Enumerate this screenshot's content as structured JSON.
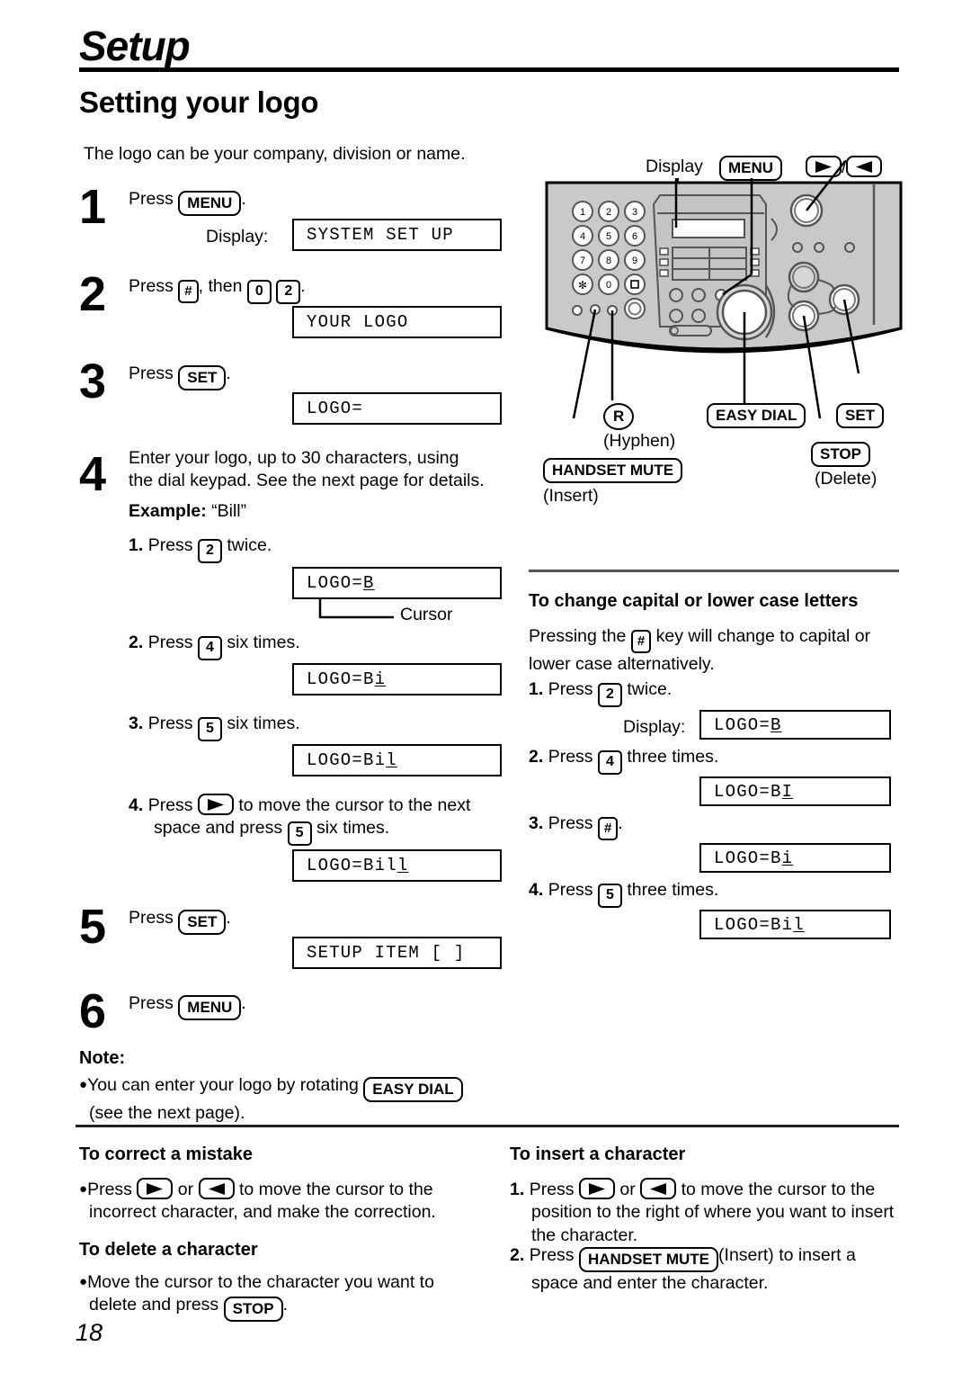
{
  "header": {
    "chapter": "Setup",
    "section_title": "Setting your logo",
    "intro": "The logo can be your company, division or name."
  },
  "page_number": "18",
  "steps": [
    {
      "number": "1",
      "text_before": "Press",
      "key": "MENU",
      "text_after": ".",
      "display_label": "Display:",
      "display_value": "SYSTEM SET UP"
    },
    {
      "number": "2",
      "text_before": "Press",
      "key": "#",
      "text_mid": ", then",
      "key2": "0",
      "key3": "2",
      "text_after": ".",
      "display_value": "YOUR LOGO"
    },
    {
      "number": "3",
      "text_before": "Press",
      "key": "SET",
      "text_after": ".",
      "display_value": "LOGO="
    },
    {
      "number": "4",
      "text_line1": "Enter your logo, up to 30 characters, using",
      "text_line2": "the dial keypad. See the next page for details.",
      "example_label": "Example:",
      "example_value": "“Bill”",
      "cursor_callout": "Cursor",
      "substeps": [
        {
          "n": "1.",
          "before": "Press",
          "key": "2",
          "after": "twice.",
          "display": "LOGO=B",
          "cursor_char": "B"
        },
        {
          "n": "2.",
          "before": "Press",
          "key": "4",
          "after": "six times.",
          "display": "LOGO=Bi",
          "cursor_char": "i"
        },
        {
          "n": "3.",
          "before": "Press",
          "key": "5",
          "after": "six times.",
          "display": "LOGO=Bil",
          "cursor_char": "l"
        },
        {
          "n": "4.",
          "before": "Press",
          "key": "right-arrow",
          "after_line1": "to move the cursor to the next",
          "after_line2a": "space and press",
          "key2": "5",
          "after_line2b": "six times.",
          "display": "LOGO=Bill",
          "cursor_char": "l"
        }
      ]
    },
    {
      "number": "5",
      "text_before": "Press",
      "key": "SET",
      "text_after": ".",
      "display_value": "SETUP ITEM [  ]"
    },
    {
      "number": "6",
      "text_before": "Press",
      "key": "MENU",
      "text_after": "."
    }
  ],
  "note": {
    "heading": "Note:",
    "line1_before": "You can enter your logo by rotating",
    "line1_key": "EASY DIAL",
    "line2": "(see the next page)."
  },
  "diagram": {
    "display_label": "Display",
    "menu_key": "MENU",
    "arrow_separator": "/",
    "right_arrow": "right-arrow-icon",
    "left_arrow": "left-arrow-icon",
    "callouts": [
      {
        "key": "HANDSET MUTE",
        "sub": "(Insert)"
      },
      {
        "key": "R",
        "sub": "(Hyphen)"
      },
      {
        "key": "EASY DIAL",
        "sub": ""
      },
      {
        "key": "SET",
        "sub": ""
      },
      {
        "key": "STOP",
        "sub": "(Delete)"
      }
    ],
    "keypad": [
      "1",
      "2",
      "3",
      "4",
      "5",
      "6",
      "7",
      "8",
      "9",
      "✱",
      "0",
      "#"
    ]
  },
  "capital_section": {
    "heading": "To change capital or lower case letters",
    "para_line1_before": "Pressing the",
    "para_line1_key": "#",
    "para_line1_after": "key will change to capital or",
    "para_line2": "lower case alternatively.",
    "steps": [
      {
        "n": "1.",
        "before": "Press",
        "key": "2",
        "after": "twice.",
        "display_label": "Display:",
        "display": "LOGO=B",
        "cursor_char": "B"
      },
      {
        "n": "2.",
        "before": "Press",
        "key": "4",
        "after": "three times.",
        "display": "LOGO=BI",
        "cursor_char": "I"
      },
      {
        "n": "3.",
        "before": "Press",
        "key": "#",
        "after": ".",
        "display": "LOGO=Bi",
        "cursor_char": "i"
      },
      {
        "n": "4.",
        "before": "Press",
        "key": "5",
        "after": "three times.",
        "display": "LOGO=Bil",
        "cursor_char": "l"
      }
    ]
  },
  "correct_section": {
    "heading": "To correct a mistake",
    "line1_before": "Press",
    "line1_mid": "or",
    "line1_after": "to move the cursor to the",
    "line2": "incorrect character, and make the correction."
  },
  "delete_section": {
    "heading": "To delete a character",
    "line1": "Move the cursor to the character you want to",
    "line2_before": "delete and press",
    "line2_key": "STOP",
    "line2_after": "."
  },
  "insert_section": {
    "heading": "To insert a character",
    "step1_n": "1.",
    "step1_before": "Press",
    "step1_mid": "or",
    "step1_after": "to move the cursor to the",
    "step1_line2": "position to the right of where you want to insert",
    "step1_line3": "the character.",
    "step2_n": "2.",
    "step2_before": "Press",
    "step2_key": "HANDSET MUTE",
    "step2_after": "(Insert) to insert a",
    "step2_line2": "space and enter the character."
  }
}
